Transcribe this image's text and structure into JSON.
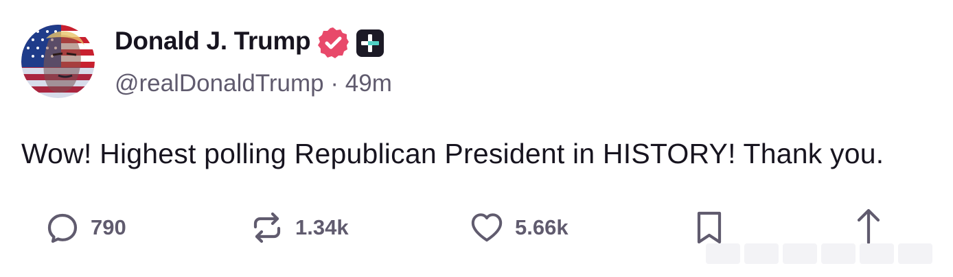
{
  "post": {
    "author": {
      "display_name": "Donald J. Trump",
      "handle": "@realDonaldTrump",
      "separator": "·",
      "time_ago": "49m",
      "avatar_icon": "flag-portrait-avatar",
      "verified_icon": "verified-check-icon",
      "badge_icon": "plus-badge-icon"
    },
    "text": "Wow! Highest polling Republican President in HISTORY! Thank you.",
    "actions": {
      "reply_count": "790",
      "repost_count": "1.34k",
      "like_count": "5.66k",
      "reply_icon": "reply-bubble-icon",
      "repost_icon": "repost-arrows-icon",
      "like_icon": "heart-icon",
      "bookmark_icon": "bookmark-icon",
      "share_icon": "share-arrow-icon"
    }
  },
  "colors": {
    "text_primary": "#17141f",
    "text_secondary": "#605b6e",
    "verified_badge": "#e8496a",
    "plus_badge_bg": "#1c1a26",
    "plus_badge_accent": "#4fd1c5"
  }
}
